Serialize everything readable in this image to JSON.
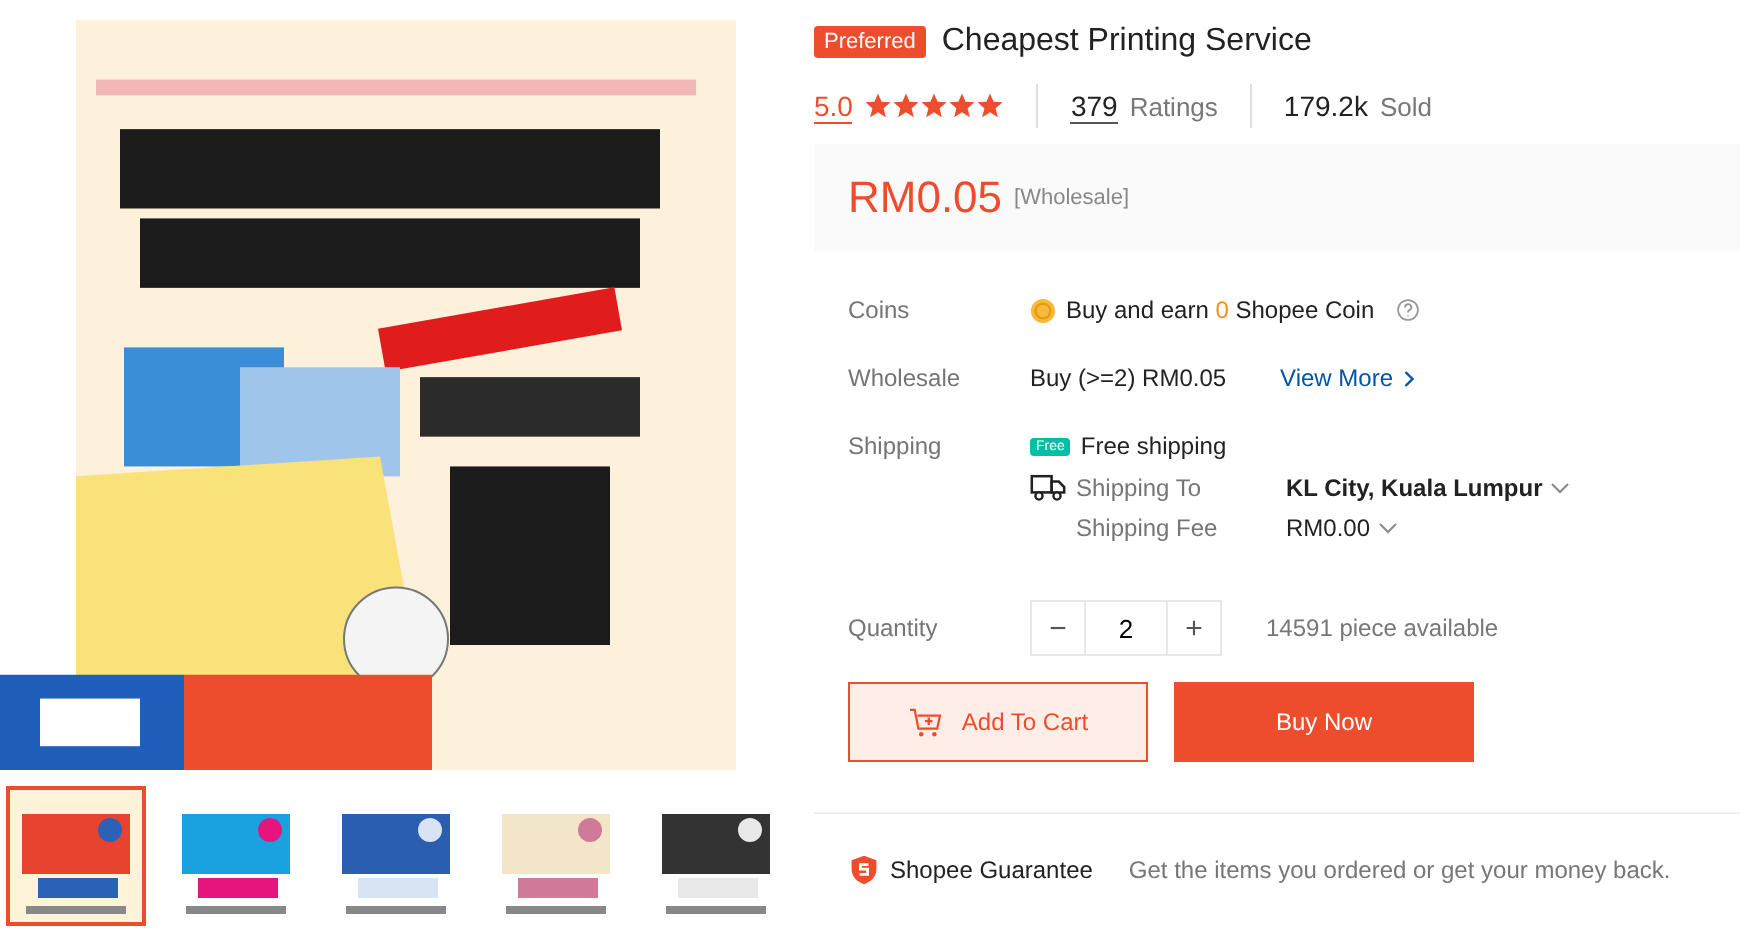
{
  "gallery": {
    "main_image": {
      "kind": "picture"
    },
    "thumbnails": [
      {
        "kind": "picture",
        "selected": true
      },
      {
        "kind": "picture",
        "selected": false
      },
      {
        "kind": "picture",
        "selected": false
      },
      {
        "kind": "picture",
        "selected": false
      },
      {
        "kind": "picture",
        "selected": false
      }
    ]
  },
  "product": {
    "badge": "Preferred",
    "title": "Cheapest Printing Service",
    "rating": "5.0",
    "stars": 5,
    "ratings_count": "379",
    "ratings_label": "Ratings",
    "sold_count": "179.2k",
    "sold_label": "Sold",
    "price": "RM0.05",
    "price_note": "[Wholesale]"
  },
  "coins": {
    "label": "Coins",
    "text_before": "Buy and earn",
    "amount": "0",
    "text_after": "Shopee Coin"
  },
  "wholesale": {
    "label": "Wholesale",
    "text": "Buy (>=2) RM0.05",
    "link": "View More"
  },
  "shipping": {
    "label": "Shipping",
    "free_badge": "Free",
    "free_text": "Free shipping",
    "to_label": "Shipping To",
    "to_value": "KL City, Kuala Lumpur",
    "fee_label": "Shipping Fee",
    "fee_value": "RM0.00"
  },
  "quantity": {
    "label": "Quantity",
    "minus": "−",
    "value": "2",
    "plus": "+",
    "available": "14591 piece available"
  },
  "buttons": {
    "add_to_cart": "Add To Cart",
    "buy_now": "Buy Now"
  },
  "guarantee": {
    "title": "Shopee Guarantee",
    "text": "Get the items you ordered or get your money back."
  }
}
